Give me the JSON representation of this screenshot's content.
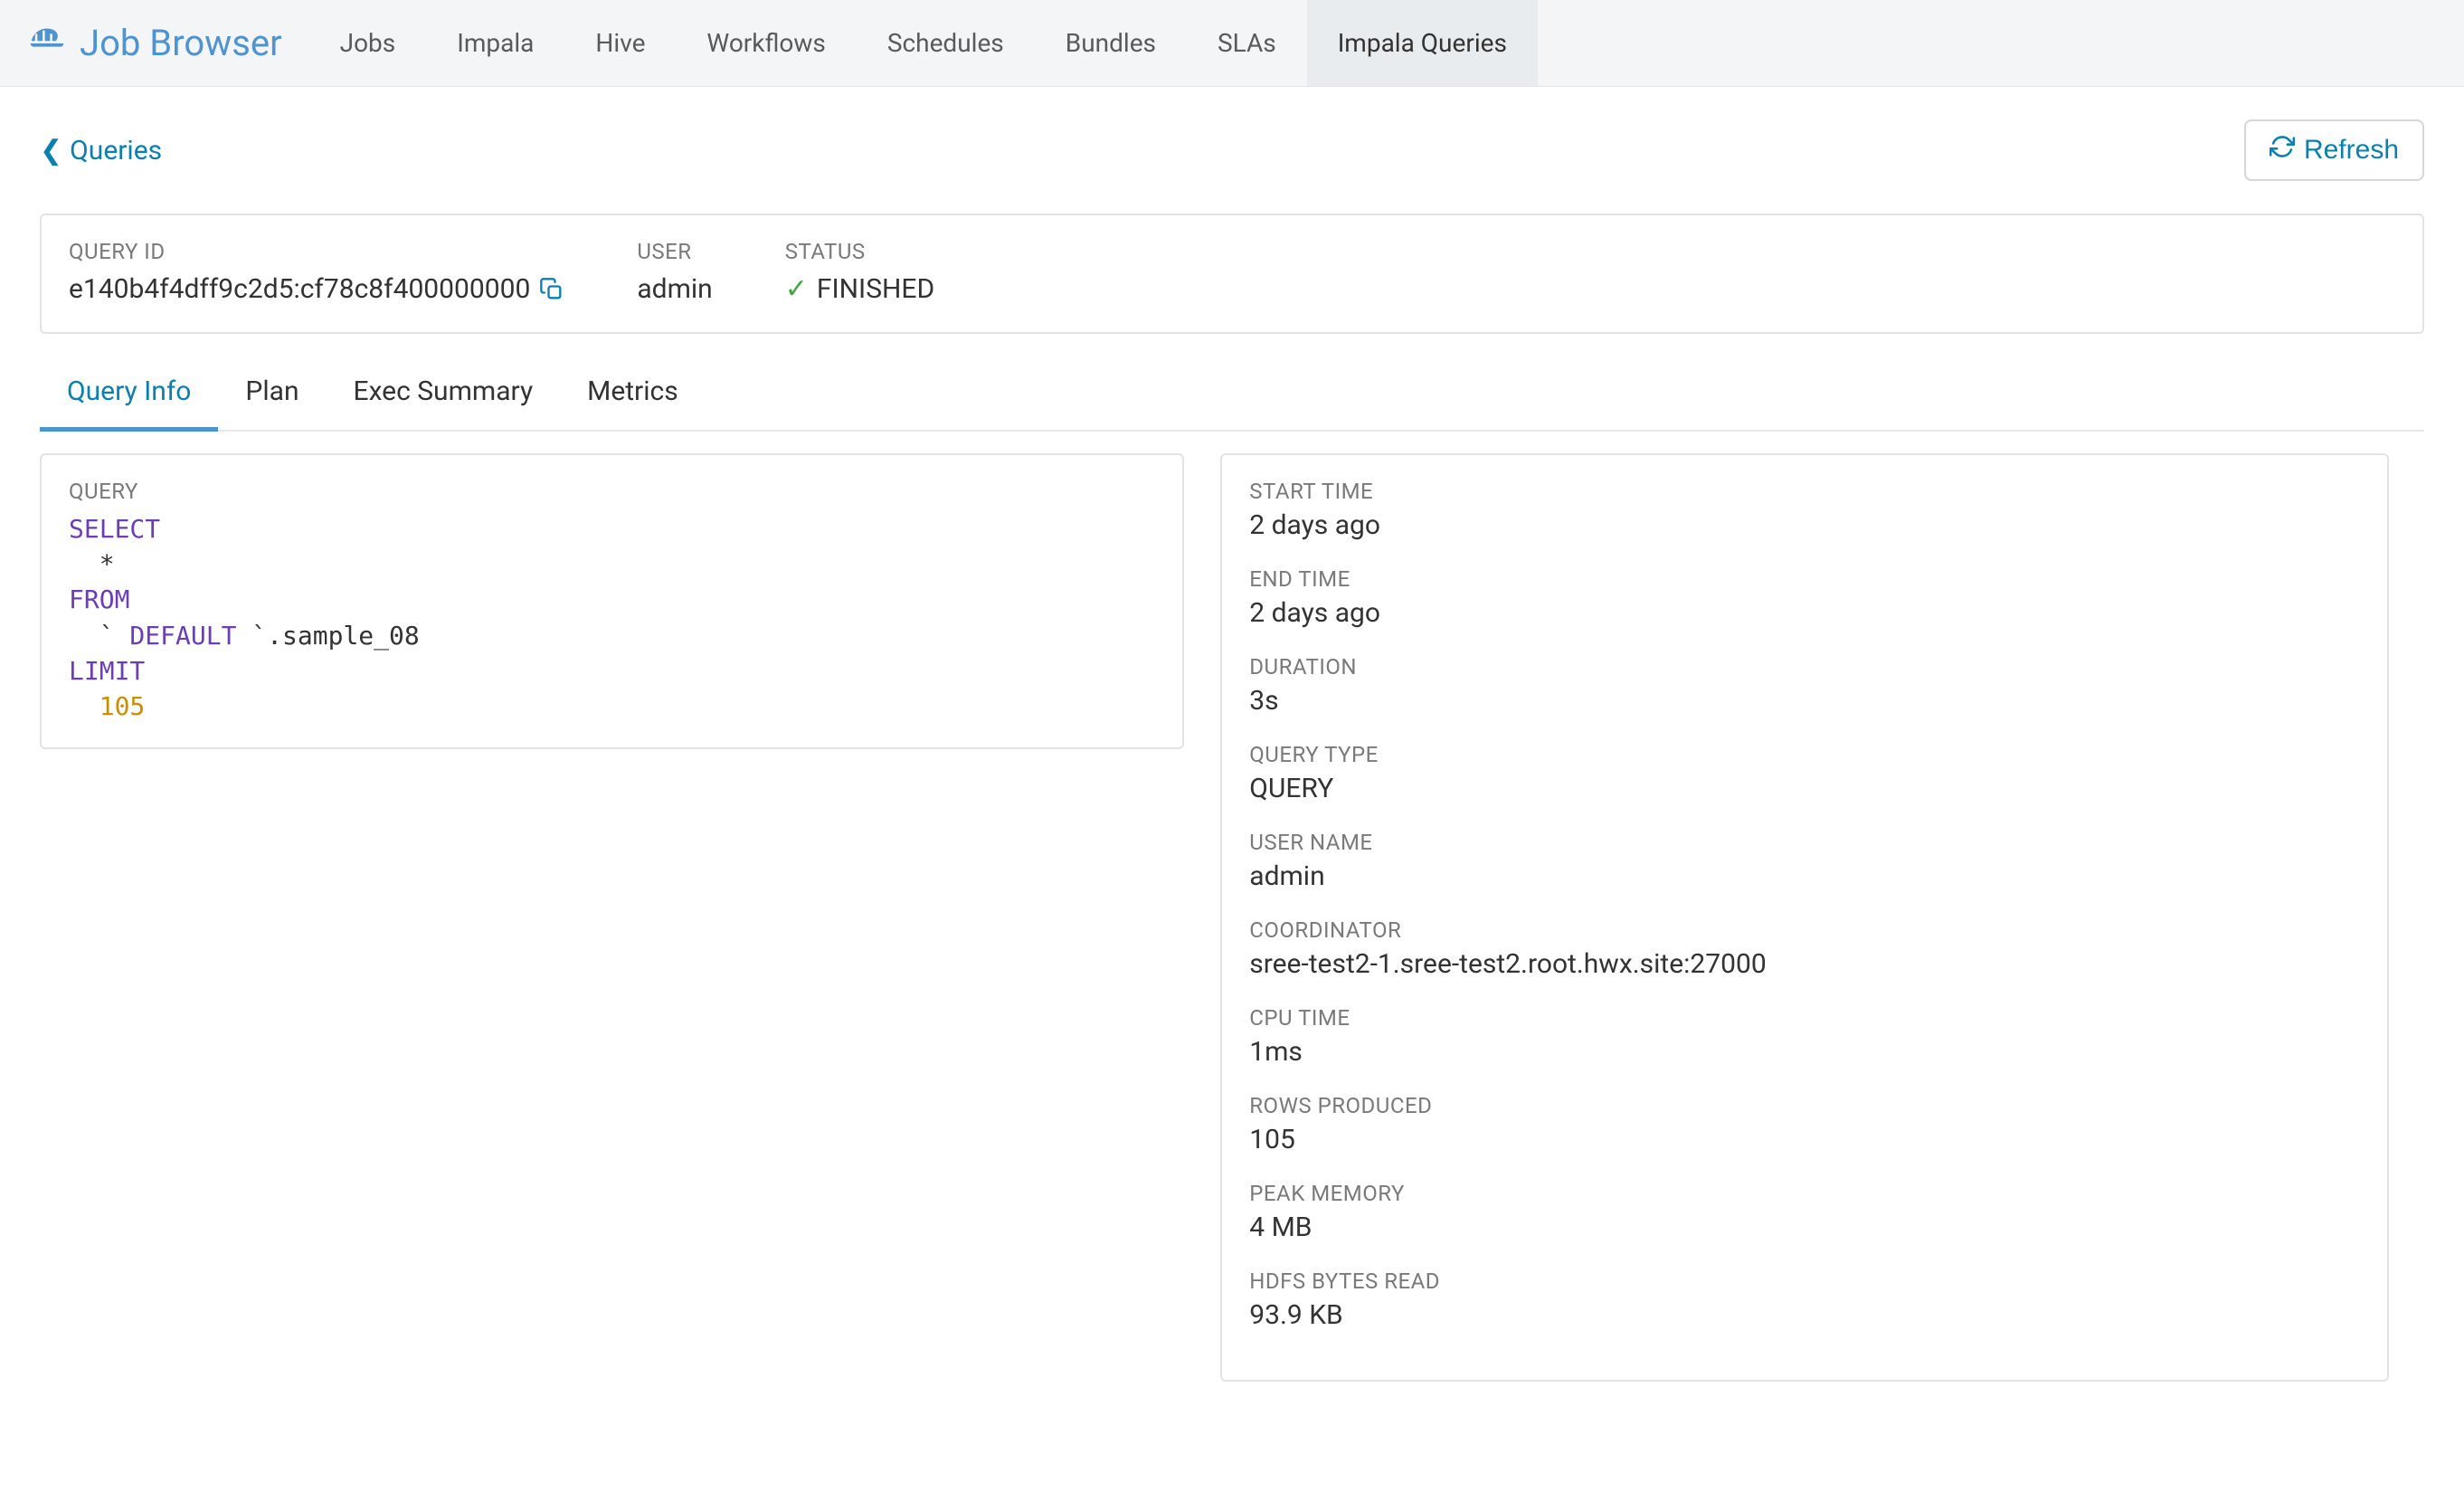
{
  "header": {
    "brand": "Job Browser",
    "tabs": [
      "Jobs",
      "Impala",
      "Hive",
      "Workflows",
      "Schedules",
      "Bundles",
      "SLAs",
      "Impala Queries"
    ],
    "active_tab_index": 7
  },
  "page": {
    "back_link_label": "Queries",
    "refresh_label": "Refresh"
  },
  "summary": {
    "query_id": {
      "label": "QUERY ID",
      "value": "e140b4f4dff9c2d5:cf78c8f400000000"
    },
    "user": {
      "label": "USER",
      "value": "admin"
    },
    "status": {
      "label": "STATUS",
      "value": "FINISHED"
    }
  },
  "detail_tabs": {
    "items": [
      "Query Info",
      "Plan",
      "Exec Summary",
      "Metrics"
    ],
    "active_index": 0
  },
  "query_panel": {
    "label": "QUERY",
    "sql": {
      "kw_select": "SELECT",
      "star_line": "  *",
      "kw_from": "FROM",
      "from_line_backtick1": "  `",
      "from_line_default": " DEFAULT ",
      "from_line_backtick2": "`",
      "from_line_rest": ".sample_08",
      "kw_limit": "LIMIT",
      "limit_val": "  105"
    }
  },
  "meta": {
    "rows": [
      {
        "label": "START TIME",
        "value": "2 days ago"
      },
      {
        "label": "END TIME",
        "value": "2 days ago"
      },
      {
        "label": "DURATION",
        "value": "3s"
      },
      {
        "label": "QUERY TYPE",
        "value": "QUERY"
      },
      {
        "label": "USER NAME",
        "value": "admin"
      },
      {
        "label": "COORDINATOR",
        "value": "sree-test2-1.sree-test2.root.hwx.site:27000"
      },
      {
        "label": "CPU TIME",
        "value": "1ms"
      },
      {
        "label": "ROWS PRODUCED",
        "value": "105"
      },
      {
        "label": "PEAK MEMORY",
        "value": "4 MB"
      },
      {
        "label": "HDFS BYTES READ",
        "value": "93.9 KB"
      }
    ]
  }
}
